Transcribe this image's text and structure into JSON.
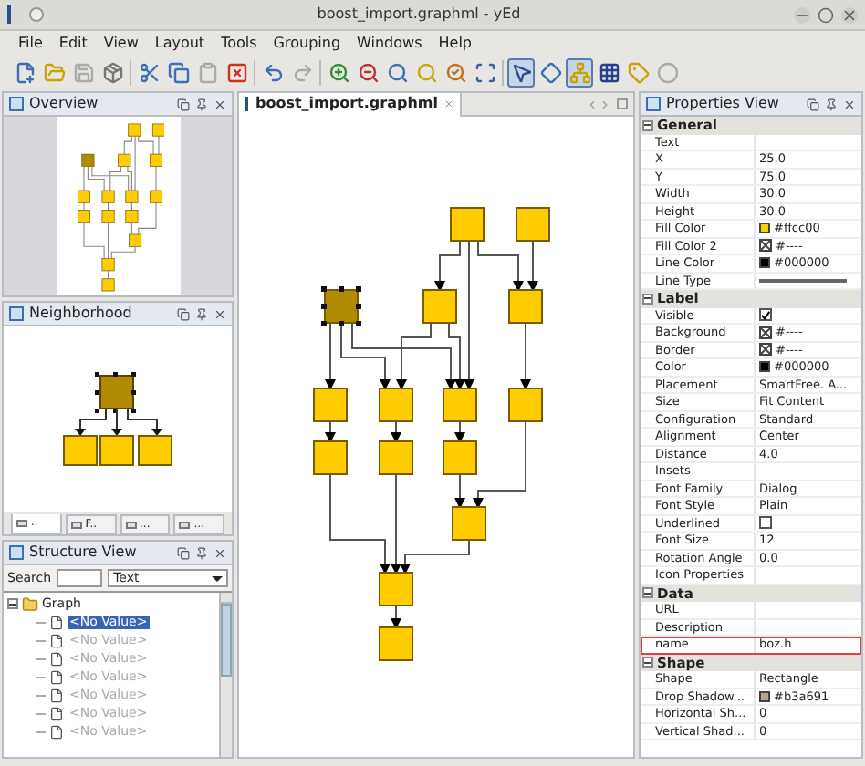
{
  "window": {
    "title": "boost_import.graphml - yEd"
  },
  "menu": [
    "File",
    "Edit",
    "View",
    "Layout",
    "Tools",
    "Grouping",
    "Windows",
    "Help"
  ],
  "toolbar": [
    {
      "kind": "new",
      "selected": false,
      "disabled": false
    },
    {
      "kind": "open",
      "selected": false,
      "disabled": false
    },
    {
      "kind": "save",
      "selected": false,
      "disabled": true
    },
    {
      "kind": "export",
      "selected": false,
      "disabled": false
    },
    {
      "kind": "separator"
    },
    {
      "kind": "cut",
      "selected": false,
      "disabled": false
    },
    {
      "kind": "copy",
      "selected": false,
      "disabled": false
    },
    {
      "kind": "paste",
      "selected": false,
      "disabled": true
    },
    {
      "kind": "delete",
      "selected": false,
      "disabled": false
    },
    {
      "kind": "separator"
    },
    {
      "kind": "undo",
      "selected": false,
      "disabled": false
    },
    {
      "kind": "redo",
      "selected": false,
      "disabled": true
    },
    {
      "kind": "separator"
    },
    {
      "kind": "zoom_in",
      "selected": false,
      "disabled": false
    },
    {
      "kind": "zoom_out",
      "selected": false,
      "disabled": false
    },
    {
      "kind": "zoom_area",
      "selected": false,
      "disabled": false
    },
    {
      "kind": "zoom_original",
      "selected": false,
      "disabled": false
    },
    {
      "kind": "zoom_selection",
      "selected": false,
      "disabled": false
    },
    {
      "kind": "fit",
      "selected": false,
      "disabled": false
    },
    {
      "kind": "separator"
    },
    {
      "kind": "edit_mode",
      "selected": true,
      "disabled": false
    },
    {
      "kind": "navigate",
      "selected": false,
      "disabled": false
    },
    {
      "kind": "hierarchy",
      "selected": true,
      "disabled": false
    },
    {
      "kind": "grid",
      "selected": false,
      "disabled": false
    },
    {
      "kind": "label",
      "selected": false,
      "disabled": false
    },
    {
      "kind": "plugin",
      "selected": false,
      "disabled": true
    }
  ],
  "overview": {
    "title": "Overview"
  },
  "neighborhood": {
    "title": "Neighborhood"
  },
  "left_tabs": [
    {
      "label": "..",
      "selected": true
    },
    {
      "label": "F..",
      "selected": false
    },
    {
      "label": "...",
      "selected": false
    },
    {
      "label": "...",
      "selected": false
    }
  ],
  "structure": {
    "title": "Structure View",
    "search_label": "Search",
    "filter": "Text",
    "tree": {
      "label": "Graph",
      "expanded": true,
      "children": [
        {
          "label": "<No Value>",
          "selected": true
        },
        {
          "label": "<No Value>",
          "selected": false
        },
        {
          "label": "<No Value>",
          "selected": false
        },
        {
          "label": "<No Value>",
          "selected": false
        },
        {
          "label": "<No Value>",
          "selected": false
        },
        {
          "label": "<No Value>",
          "selected": false
        },
        {
          "label": "<No Value>",
          "selected": false
        }
      ]
    }
  },
  "editor": {
    "tab": "boost_import.graphml",
    "graph": {
      "nodes": [
        {
          "selected": false
        },
        {
          "selected": false
        },
        {
          "selected": true
        },
        {
          "selected": false
        },
        {
          "selected": false
        },
        {
          "selected": false
        },
        {
          "selected": false
        },
        {
          "selected": false
        },
        {
          "selected": false
        },
        {
          "selected": false
        },
        {
          "selected": false
        },
        {
          "selected": false
        },
        {
          "selected": false
        },
        {
          "selected": false
        },
        {
          "selected": false
        }
      ]
    }
  },
  "properties": {
    "title": "Properties View",
    "sections": [
      {
        "title": "General",
        "expanded": true,
        "rows": [
          {
            "name": "Text",
            "kind": "text"
          },
          {
            "name": "X",
            "value": "25.0",
            "kind": "text"
          },
          {
            "name": "Y",
            "value": "75.0",
            "kind": "text"
          },
          {
            "name": "Width",
            "value": "30.0",
            "kind": "text"
          },
          {
            "name": "Height",
            "value": "30.0",
            "kind": "text"
          },
          {
            "name": "Fill Color",
            "value": "#ffcc00",
            "kind": "color",
            "color": "#ffcc00"
          },
          {
            "name": "Fill Color 2",
            "value": "#----",
            "kind": "nocolor"
          },
          {
            "name": "Line Color",
            "value": "#000000",
            "kind": "color",
            "color": "#000000"
          },
          {
            "name": "Line Type",
            "kind": "line"
          }
        ]
      },
      {
        "title": "Label",
        "expanded": true,
        "rows": [
          {
            "name": "Visible",
            "kind": "checkbox",
            "checked": true
          },
          {
            "name": "Background",
            "value": "#----",
            "kind": "nocolor"
          },
          {
            "name": "Border",
            "value": "#----",
            "kind": "nocolor"
          },
          {
            "name": "Color",
            "value": "#000000",
            "kind": "color",
            "color": "#000000"
          },
          {
            "name": "Placement",
            "value": "SmartFree. A...",
            "kind": "text"
          },
          {
            "name": "Size",
            "value": "Fit Content",
            "kind": "text"
          },
          {
            "name": "Configuration",
            "value": "Standard",
            "kind": "text"
          },
          {
            "name": "Alignment",
            "value": "Center",
            "kind": "text"
          },
          {
            "name": "Distance",
            "value": "4.0",
            "kind": "text"
          },
          {
            "name": "Insets",
            "kind": "text"
          },
          {
            "name": "Font Family",
            "value": "Dialog",
            "kind": "text"
          },
          {
            "name": "Font Style",
            "value": "Plain",
            "kind": "text"
          },
          {
            "name": "Underlined",
            "kind": "checkbox",
            "checked": false
          },
          {
            "name": "Font Size",
            "value": "12",
            "kind": "text"
          },
          {
            "name": "Rotation Angle",
            "value": "0.0",
            "kind": "text"
          },
          {
            "name": "Icon Properties",
            "kind": "text"
          }
        ]
      },
      {
        "title": "Data",
        "expanded": true,
        "rows": [
          {
            "name": "URL",
            "kind": "text"
          },
          {
            "name": "Description",
            "kind": "text"
          },
          {
            "name": "name",
            "value": "boz.h",
            "kind": "text",
            "highlighted": true
          }
        ]
      },
      {
        "title": "Shape",
        "expanded": true,
        "rows": [
          {
            "name": "Shape",
            "value": "Rectangle",
            "kind": "text"
          },
          {
            "name": "Drop Shadow...",
            "value": "#b3a691",
            "kind": "color",
            "color": "#b3a691"
          },
          {
            "name": "Horizontal Sh...",
            "value": "0",
            "kind": "text"
          },
          {
            "name": "Vertical Shad...",
            "value": "0",
            "kind": "text"
          }
        ]
      }
    ]
  }
}
